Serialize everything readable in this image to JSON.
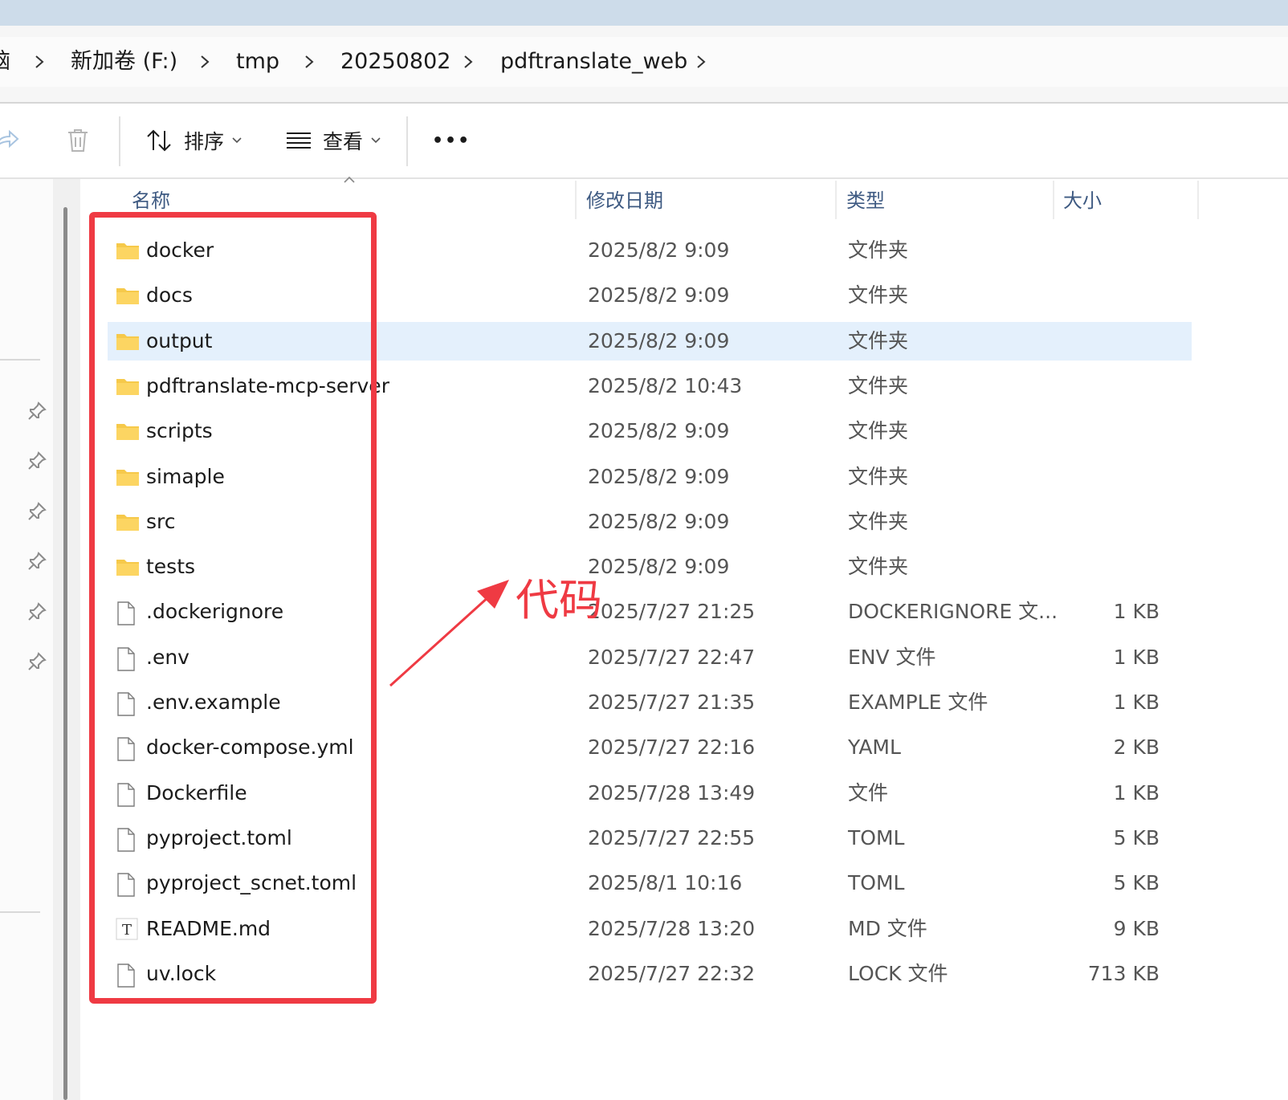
{
  "breadcrumb": {
    "partial_first": "脑",
    "items": [
      "新加卷 (F:)",
      "tmp",
      "20250802",
      "pdftranslate_web"
    ]
  },
  "toolbar": {
    "sort_label": "排序",
    "view_label": "查看",
    "more_label": "•••"
  },
  "columns": {
    "name": "名称",
    "date": "修改日期",
    "type": "类型",
    "size": "大小"
  },
  "files": [
    {
      "name": "docker",
      "date": "2025/8/2 9:09",
      "type": "文件夹",
      "size": "",
      "icon": "folder-icon",
      "selected": false
    },
    {
      "name": "docs",
      "date": "2025/8/2 9:09",
      "type": "文件夹",
      "size": "",
      "icon": "folder-icon",
      "selected": false
    },
    {
      "name": "output",
      "date": "2025/8/2 9:09",
      "type": "文件夹",
      "size": "",
      "icon": "folder-icon",
      "selected": true
    },
    {
      "name": "pdftranslate-mcp-server",
      "date": "2025/8/2 10:43",
      "type": "文件夹",
      "size": "",
      "icon": "folder-icon",
      "selected": false
    },
    {
      "name": "scripts",
      "date": "2025/8/2 9:09",
      "type": "文件夹",
      "size": "",
      "icon": "folder-icon",
      "selected": false
    },
    {
      "name": "simaple",
      "date": "2025/8/2 9:09",
      "type": "文件夹",
      "size": "",
      "icon": "folder-icon",
      "selected": false
    },
    {
      "name": "src",
      "date": "2025/8/2 9:09",
      "type": "文件夹",
      "size": "",
      "icon": "folder-icon",
      "selected": false
    },
    {
      "name": "tests",
      "date": "2025/8/2 9:09",
      "type": "文件夹",
      "size": "",
      "icon": "folder-icon",
      "selected": false
    },
    {
      "name": ".dockerignore",
      "date": "2025/7/27 21:25",
      "type": "DOCKERIGNORE 文...",
      "size": "1 KB",
      "icon": "file-icon",
      "selected": false
    },
    {
      "name": ".env",
      "date": "2025/7/27 22:47",
      "type": "ENV 文件",
      "size": "1 KB",
      "icon": "file-icon",
      "selected": false
    },
    {
      "name": ".env.example",
      "date": "2025/7/27 21:35",
      "type": "EXAMPLE 文件",
      "size": "1 KB",
      "icon": "file-icon",
      "selected": false
    },
    {
      "name": "docker-compose.yml",
      "date": "2025/7/27 22:16",
      "type": "YAML",
      "size": "2 KB",
      "icon": "file-icon",
      "selected": false
    },
    {
      "name": "Dockerfile",
      "date": "2025/7/28 13:49",
      "type": "文件",
      "size": "1 KB",
      "icon": "file-icon",
      "selected": false
    },
    {
      "name": "pyproject.toml",
      "date": "2025/7/27 22:55",
      "type": "TOML",
      "size": "5 KB",
      "icon": "file-icon",
      "selected": false
    },
    {
      "name": "pyproject_scnet.toml",
      "date": "2025/8/1 10:16",
      "type": "TOML",
      "size": "5 KB",
      "icon": "file-icon",
      "selected": false
    },
    {
      "name": "README.md",
      "date": "2025/7/28 13:20",
      "type": "MD 文件",
      "size": "9 KB",
      "icon": "text-file-icon",
      "selected": false
    },
    {
      "name": "uv.lock",
      "date": "2025/7/27 22:32",
      "type": "LOCK 文件",
      "size": "713 KB",
      "icon": "file-icon",
      "selected": false
    }
  ],
  "annotation": {
    "label": "代码",
    "color": "#ef3a43"
  },
  "colors": {
    "selection": "#e4f0fc",
    "title_strip": "#cddcea",
    "header_text": "#3e5a82",
    "folder": "#f6c94a"
  }
}
